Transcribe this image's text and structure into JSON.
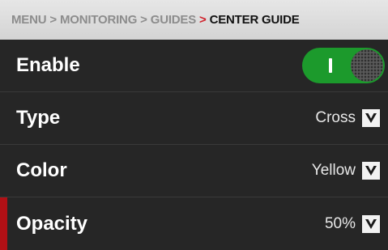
{
  "breadcrumb": {
    "items": [
      "MENU",
      "MONITORING",
      "GUIDES",
      "CENTER GUIDE"
    ],
    "separator": ">"
  },
  "settings": {
    "enable": {
      "label": "Enable",
      "state": "on"
    },
    "type": {
      "label": "Type",
      "value": "Cross"
    },
    "color": {
      "label": "Color",
      "value": "Yellow"
    },
    "opacity": {
      "label": "Opacity",
      "value": "50%"
    }
  },
  "colors": {
    "accent": "#d0202a",
    "toggle_on": "#1c9a2c",
    "selection_marker": "#b01015"
  },
  "icons": {
    "dropdown": "chevron-down-icon"
  }
}
